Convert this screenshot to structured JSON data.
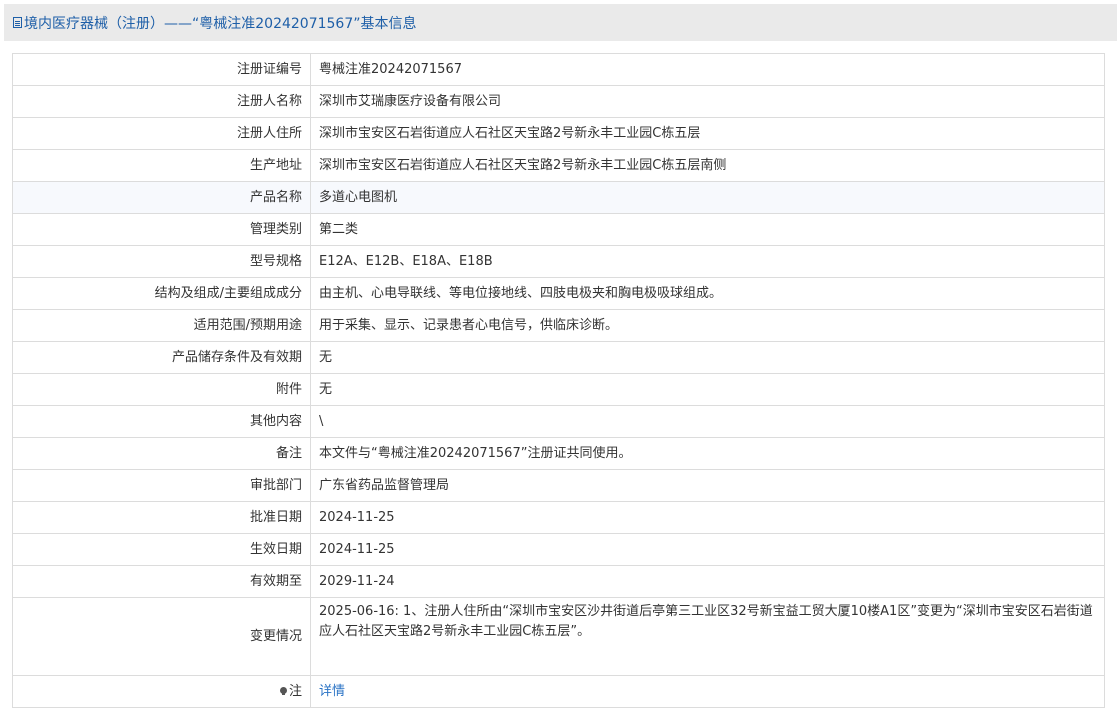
{
  "header": {
    "title": "境内医疗器械（注册）——“粤械注准20242071567”基本信息"
  },
  "rows": [
    {
      "label": "注册证编号",
      "value": "粤械注准20242071567"
    },
    {
      "label": "注册人名称",
      "value": "深圳市艾瑞康医疗设备有限公司"
    },
    {
      "label": "注册人住所",
      "value": "深圳市宝安区石岩街道应人石社区天宝路2号新永丰工业园C栋五层"
    },
    {
      "label": "生产地址",
      "value": "深圳市宝安区石岩街道应人石社区天宝路2号新永丰工业园C栋五层南侧"
    },
    {
      "label": "产品名称",
      "value": "多道心电图机"
    },
    {
      "label": "管理类别",
      "value": "第二类"
    },
    {
      "label": "型号规格",
      "value": "E12A、E12B、E18A、E18B"
    },
    {
      "label": "结构及组成/主要组成成分",
      "value": "由主机、心电导联线、等电位接地线、四肢电极夹和胸电极吸球组成。"
    },
    {
      "label": "适用范围/预期用途",
      "value": "用于采集、显示、记录患者心电信号，供临床诊断。"
    },
    {
      "label": "产品储存条件及有效期",
      "value": "无"
    },
    {
      "label": "附件",
      "value": "无"
    },
    {
      "label": "其他内容",
      "value": "\\"
    },
    {
      "label": "备注",
      "value": "本文件与“粤械注准20242071567”注册证共同使用。"
    },
    {
      "label": "审批部门",
      "value": "广东省药品监督管理局"
    },
    {
      "label": "批准日期",
      "value": "2024-11-25"
    },
    {
      "label": "生效日期",
      "value": "2024-11-25"
    },
    {
      "label": "有效期至",
      "value": "2029-11-24"
    },
    {
      "label": "变更情况",
      "value": "2025-06-16: 1、注册人住所由“深圳市宝安区沙井街道后亭第三工业区32号新宝益工贸大厦10楼A1区”变更为“深圳市宝安区石岩街道应人石社区天宝路2号新永丰工业园C栋五层”。"
    },
    {
      "label": "注",
      "value": "详情"
    }
  ],
  "icons": {
    "header": "document-icon",
    "note": "lightbulb-icon"
  },
  "colors": {
    "title": "#1e5fa8",
    "link": "#2a73c5",
    "header_bg": "#eaeaea",
    "highlight_row": "#f7f9fd"
  }
}
